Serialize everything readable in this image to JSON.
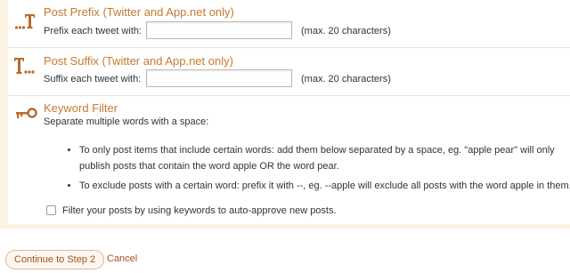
{
  "prefix": {
    "title": "Post Prefix (Twitter and App.net only)",
    "field_label": "Prefix each tweet with:",
    "value": "",
    "hint": "(max. 20 characters)",
    "icon": "prefix-icon"
  },
  "suffix": {
    "title": "Post Suffix (Twitter and App.net only)",
    "field_label": "Suffix each tweet with:",
    "value": "",
    "hint": "(max. 20 characters)",
    "icon": "suffix-icon"
  },
  "keyword_filter": {
    "title": "Keyword Filter",
    "description": "Separate multiple words with a space:",
    "icon": "key-icon",
    "rules": [
      "To only post items that include certain words: add them below separated by a space, eg. \"apple pear\" will only publish posts that contain the word apple OR the word pear.",
      "To exclude posts with a certain word: prefix it with --, eg. --apple will exclude all posts with the word apple in them."
    ],
    "checkbox_label": "Filter your posts by using keywords to auto-approve new posts.",
    "checkbox_checked": false
  },
  "actions": {
    "continue_label": "Continue to Step 2",
    "cancel_label": "Cancel"
  },
  "colors": {
    "accent": "#c77a30",
    "panel_bg": "#fdf3e3"
  }
}
